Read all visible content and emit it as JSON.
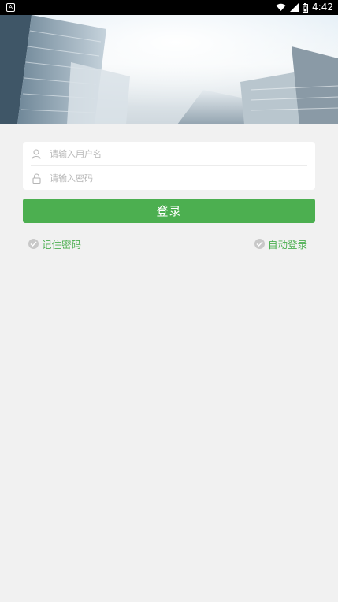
{
  "status_bar": {
    "left_icon": "A",
    "time": "4:42",
    "icons": [
      "wifi-icon",
      "signal-icon",
      "battery-icon"
    ]
  },
  "banner": {
    "description_icon": "banner-image"
  },
  "form": {
    "username": {
      "placeholder": "请输入用户名",
      "icon": "user-icon",
      "value": ""
    },
    "password": {
      "placeholder": "请输入密码",
      "icon": "lock-icon",
      "value": ""
    }
  },
  "actions": {
    "login_label": "登录",
    "remember_label": "记住密码",
    "auto_login_label": "自动登录"
  },
  "colors": {
    "accent": "#4caf50",
    "background": "#f1f1f1",
    "placeholder": "#b7b7b7"
  }
}
